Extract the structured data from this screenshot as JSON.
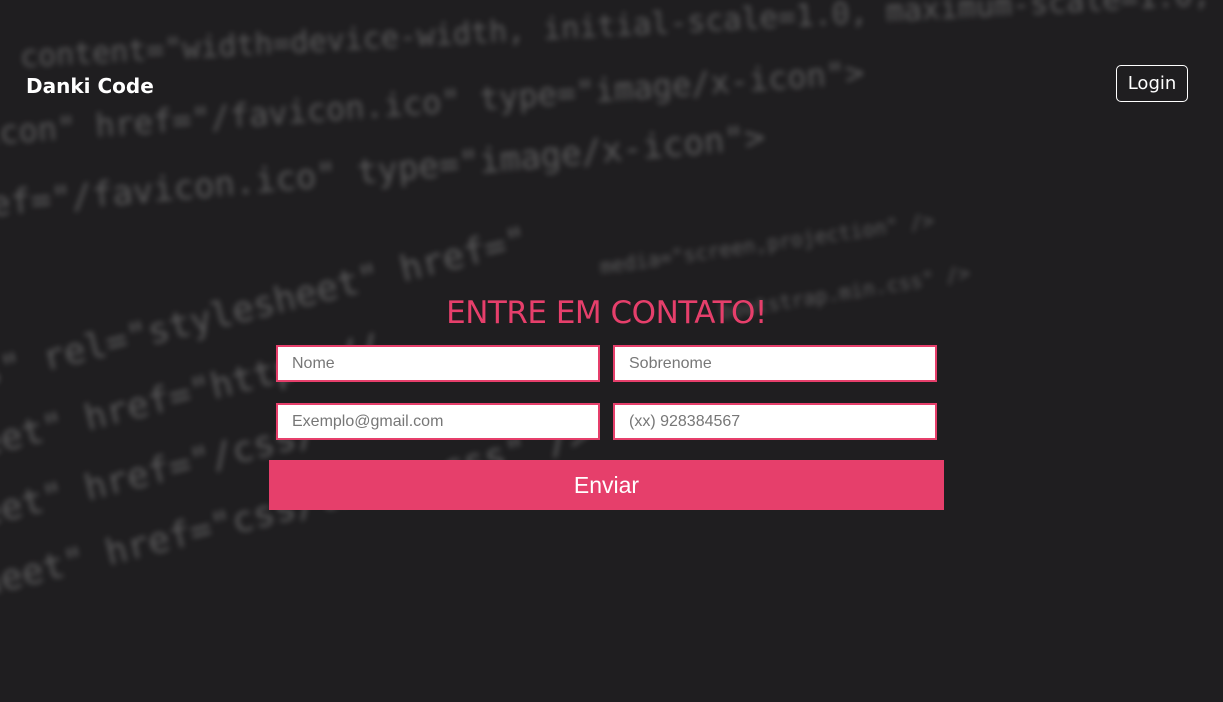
{
  "header": {
    "logo_text": "Danki Code",
    "login_label": "Login"
  },
  "contact": {
    "title": "ENTRE EM CONTATO!",
    "fields": {
      "first_name_placeholder": "Nome",
      "last_name_placeholder": "Sobrenome",
      "email_placeholder": "Exemplo@gmail.com",
      "phone_placeholder": "(xx) 928384567"
    },
    "submit_label": "Enviar"
  },
  "colors": {
    "background": "#1f1e20",
    "accent": "#e63f6b",
    "text_light": "#ffffff"
  }
}
